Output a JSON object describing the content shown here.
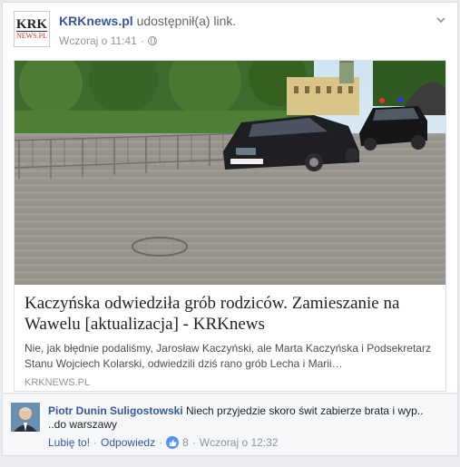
{
  "post": {
    "page_name": "KRKnews.pl",
    "shared_text": "udostępnił(a) link.",
    "timestamp": "Wczoraj o 11:41",
    "logo_text_top": "KRK",
    "logo_text_bottom": "NEWS.PL"
  },
  "link": {
    "title": "Kaczyńska odwiedziła grób rodziców. Zamieszanie na Wawelu [aktualizacja] - KRKnews",
    "description": "Nie, jak błędnie podaliśmy, Jarosław Kaczyński, ale Marta Kaczyńska i Podsekretarz Stanu Wojciech Kolarski, odwiedzili dziś rano grób Lecha i Marii…",
    "domain": "KRKNEWS.PL",
    "image_plate": "KR 0444"
  },
  "comment": {
    "author": "Piotr Dunin Suligostowski",
    "text": "Niech przyjedzie skoro świt zabierze brata i wyp.. ..do warszawy",
    "like_label": "Lubię to!",
    "reply_label": "Odpowiedz",
    "separator": "·",
    "like_count": "8",
    "timestamp": "Wczoraj o 12:32"
  },
  "colors": {
    "link_blue": "#365899",
    "meta_gray": "#90949c",
    "like_blue": "#5890ff"
  }
}
